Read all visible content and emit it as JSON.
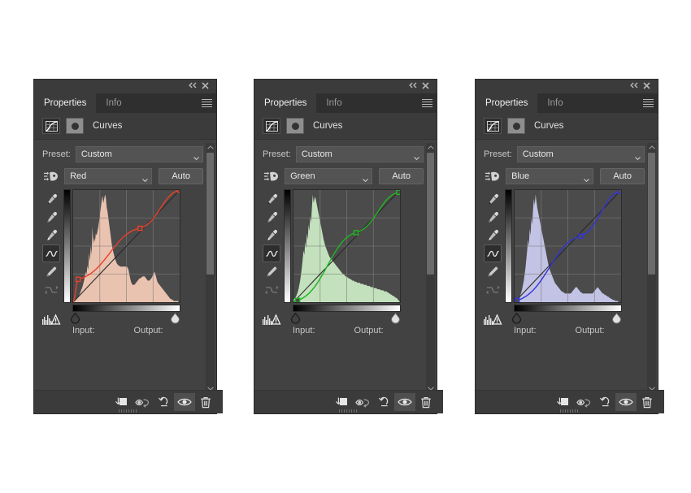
{
  "window": {
    "collapse_icon": "collapse-arrows-icon",
    "close_icon": "close-icon",
    "menu_icon": "panel-menu-icon"
  },
  "tabs": [
    {
      "label": "Properties",
      "active": true
    },
    {
      "label": "Info",
      "active": false
    }
  ],
  "adjustment": {
    "title": "Curves",
    "curve_icon": "curves-grid-icon",
    "mask_icon": "layer-mask-thumbnail"
  },
  "controls": {
    "preset_label": "Preset:",
    "preset_value": "Custom",
    "auto_label": "Auto",
    "input_label": "Input:",
    "output_label": "Output:",
    "input_value": "",
    "output_value": ""
  },
  "tools": [
    {
      "name": "black-point-eyedropper-icon",
      "selected": false,
      "dim": false
    },
    {
      "name": "gray-point-eyedropper-icon",
      "selected": false,
      "dim": false
    },
    {
      "name": "white-point-eyedropper-icon",
      "selected": false,
      "dim": false
    },
    {
      "name": "curve-point-tool-icon",
      "selected": true,
      "dim": false
    },
    {
      "name": "pencil-draw-tool-icon",
      "selected": false,
      "dim": false
    },
    {
      "name": "smooth-curve-tool-icon",
      "selected": false,
      "dim": true
    },
    {
      "name": "histogram-warning-icon",
      "selected": false,
      "dim": false
    }
  ],
  "footer_buttons": [
    {
      "name": "clip-to-layer-button",
      "active": false
    },
    {
      "name": "view-previous-state-button",
      "active": false
    },
    {
      "name": "reset-adjustment-button",
      "active": false
    },
    {
      "name": "toggle-layer-visibility-button",
      "active": true
    },
    {
      "name": "delete-adjustment-layer-button",
      "active": false
    }
  ],
  "panels": [
    {
      "id": "red",
      "channel": "Red",
      "accent": "#e8402a",
      "fill": "#f7cdb9",
      "chart_data": {
        "type": "line",
        "title": "Red channel curve",
        "xlabel": "Input",
        "ylabel": "Output",
        "xlim": [
          0,
          255
        ],
        "ylim": [
          0,
          255
        ],
        "grid": true,
        "legend": "none",
        "series": [
          {
            "name": "Red curve",
            "points": [
              [
                12,
                52
              ],
              [
                160,
                168
              ],
              [
                255,
                255
              ]
            ]
          },
          {
            "name": "Baseline diagonal",
            "points": [
              [
                0,
                0
              ],
              [
                255,
                255
              ]
            ]
          }
        ],
        "histogram": [
          2,
          2,
          2,
          3,
          3,
          4,
          5,
          6,
          8,
          10,
          12,
          14,
          17,
          20,
          24,
          28,
          26,
          34,
          30,
          46,
          38,
          52,
          44,
          70,
          54,
          60,
          56,
          64,
          62,
          66,
          70,
          76,
          82,
          88,
          94,
          99,
          92,
          96,
          100,
          97,
          88,
          84,
          78,
          72,
          66,
          60,
          54,
          50,
          46,
          43,
          40,
          38,
          36,
          35,
          34,
          34,
          33,
          33,
          33,
          33,
          33,
          33,
          33,
          33,
          33,
          32,
          30,
          26,
          22,
          19,
          17,
          16,
          16,
          16,
          17,
          18,
          19,
          20,
          21,
          22,
          22,
          23,
          23,
          24,
          24,
          24,
          23,
          22,
          21,
          20,
          20,
          20,
          21,
          22,
          23,
          25,
          27,
          28,
          26,
          23,
          20,
          18,
          17,
          16,
          15,
          14,
          13,
          12,
          11,
          10,
          9,
          8,
          7,
          6,
          5,
          4,
          3,
          3,
          2,
          2,
          1,
          1,
          1,
          1,
          1,
          1,
          0,
          0
        ]
      }
    },
    {
      "id": "green",
      "channel": "Green",
      "accent": "#20b520",
      "fill": "#cdeec6",
      "chart_data": {
        "type": "line",
        "title": "Green channel curve",
        "xlabel": "Input",
        "ylabel": "Output",
        "xlim": [
          0,
          255
        ],
        "ylim": [
          0,
          255
        ],
        "grid": true,
        "legend": "none",
        "series": [
          {
            "name": "Green curve",
            "points": [
              [
                10,
                4
              ],
              [
                150,
                158
              ],
              [
                252,
                250
              ]
            ]
          },
          {
            "name": "Baseline diagonal",
            "points": [
              [
                0,
                0
              ],
              [
                255,
                255
              ]
            ]
          }
        ],
        "histogram": [
          2,
          3,
          4,
          5,
          7,
          9,
          12,
          16,
          20,
          26,
          32,
          40,
          48,
          44,
          56,
          50,
          64,
          58,
          72,
          66,
          80,
          74,
          88,
          100,
          92,
          96,
          98,
          94,
          90,
          86,
          82,
          78,
          74,
          70,
          66,
          62,
          58,
          55,
          52,
          50,
          48,
          46,
          44,
          42,
          41,
          40,
          39,
          38,
          37,
          36,
          35,
          34,
          33,
          32,
          31,
          30,
          29,
          28,
          27,
          26,
          26,
          25,
          24,
          24,
          23,
          23,
          22,
          22,
          21,
          21,
          20,
          20,
          20,
          19,
          19,
          19,
          18,
          18,
          18,
          18,
          17,
          17,
          17,
          17,
          16,
          16,
          16,
          16,
          15,
          15,
          15,
          15,
          14,
          14,
          14,
          14,
          13,
          13,
          13,
          13,
          12,
          12,
          12,
          12,
          11,
          11,
          11,
          11,
          10,
          10,
          10,
          10,
          9,
          9,
          8,
          8,
          7,
          7,
          6,
          6,
          5,
          5,
          4,
          4,
          3,
          2,
          1,
          0
        ]
      }
    },
    {
      "id": "blue",
      "channel": "Blue",
      "accent": "#3434d8",
      "fill": "#cdcdf2",
      "chart_data": {
        "type": "line",
        "title": "Blue channel curve",
        "xlabel": "Input",
        "ylabel": "Output",
        "xlim": [
          0,
          255
        ],
        "ylim": [
          0,
          255
        ],
        "grid": true,
        "legend": "none",
        "series": [
          {
            "name": "Blue curve",
            "points": [
              [
                6,
                4
              ],
              [
                158,
                150
              ],
              [
                252,
                252
              ]
            ]
          },
          {
            "name": "Baseline diagonal",
            "points": [
              [
                0,
                0
              ],
              [
                255,
                255
              ]
            ]
          }
        ],
        "histogram": [
          1,
          1,
          2,
          2,
          3,
          4,
          5,
          7,
          9,
          12,
          16,
          20,
          26,
          32,
          40,
          48,
          58,
          52,
          68,
          62,
          78,
          72,
          86,
          96,
          90,
          100,
          94,
          88,
          84,
          80,
          76,
          72,
          68,
          64,
          60,
          56,
          52,
          48,
          44,
          40,
          36,
          33,
          30,
          28,
          26,
          24,
          22,
          20,
          18,
          17,
          16,
          15,
          14,
          13,
          12,
          11,
          10,
          10,
          9,
          9,
          8,
          8,
          8,
          8,
          8,
          8,
          8,
          8,
          9,
          10,
          11,
          12,
          13,
          14,
          14,
          13,
          12,
          11,
          10,
          9,
          9,
          8,
          8,
          8,
          8,
          8,
          8,
          8,
          8,
          8,
          8,
          8,
          8,
          8,
          9,
          10,
          11,
          12,
          13,
          14,
          13,
          12,
          11,
          10,
          9,
          8,
          8,
          7,
          7,
          6,
          6,
          5,
          5,
          4,
          4,
          3,
          3,
          2,
          2,
          2,
          1,
          1,
          1,
          1,
          0,
          0,
          0,
          0
        ]
      }
    }
  ]
}
